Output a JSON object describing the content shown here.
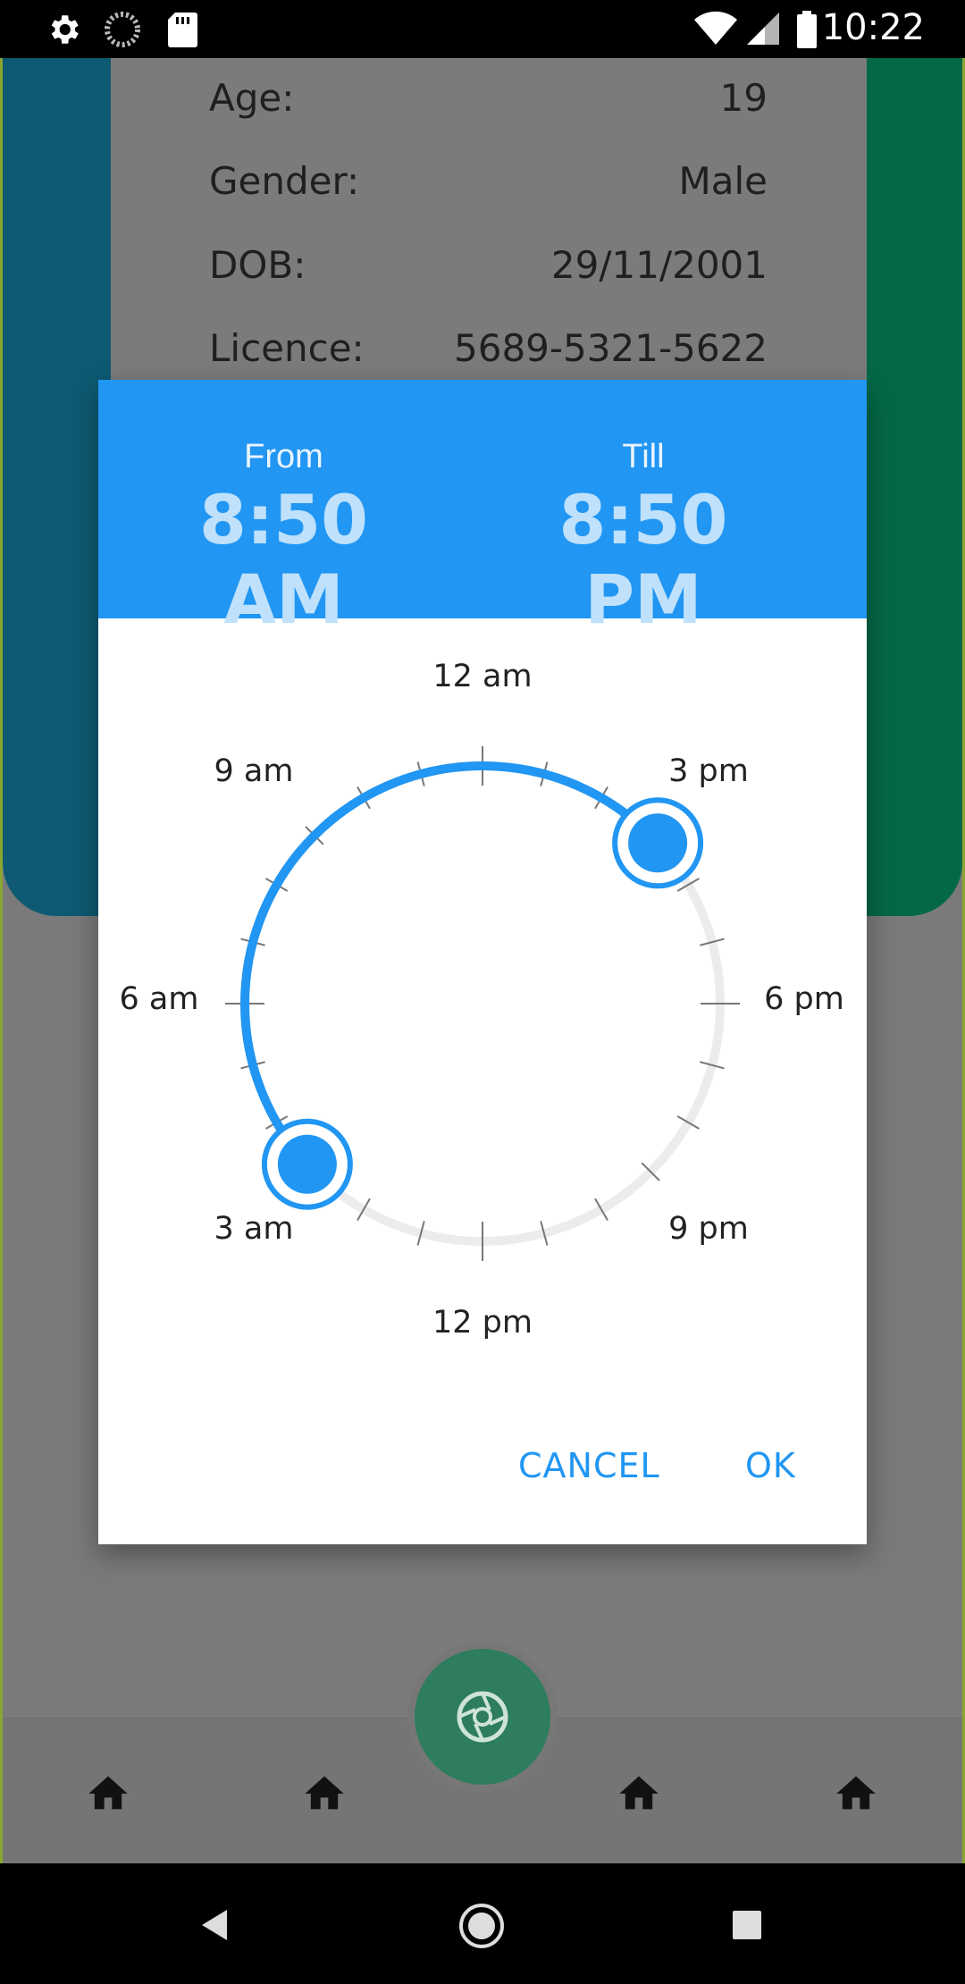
{
  "status_bar": {
    "time": "10:22",
    "icons": [
      "gear-icon",
      "loading-icon",
      "sd-card-icon",
      "wifi-icon",
      "signal-icon",
      "battery-icon"
    ]
  },
  "profile": {
    "rows": [
      {
        "label": "Age:",
        "value": "19"
      },
      {
        "label": "Gender:",
        "value": "Male"
      },
      {
        "label": "DOB:",
        "value": "29/11/2001"
      },
      {
        "label": "Licence:",
        "value": "5689-5321-5622"
      }
    ]
  },
  "dialog": {
    "from_label": "From",
    "from_time": "8:50 AM",
    "till_label": "Till",
    "till_time": "8:50 PM",
    "dial_labels": {
      "top": "12 am",
      "top_right": "3 pm",
      "right": "6 pm",
      "bottom_right": "9 pm",
      "bottom": "12 pm",
      "bottom_left": "3 am",
      "left": "6 am",
      "top_left": "9 am"
    },
    "cancel_label": "CANCEL",
    "ok_label": "OK"
  },
  "colors": {
    "accent": "#2196f3",
    "header_time": "#bfe1fb",
    "band_left": "#0d5a72",
    "band_right": "#046848",
    "fab": "#2d7d5e"
  },
  "bottom_nav": {
    "icons": [
      "home-icon",
      "home-icon",
      "camera-shutter-icon",
      "home-icon",
      "home-icon"
    ]
  }
}
